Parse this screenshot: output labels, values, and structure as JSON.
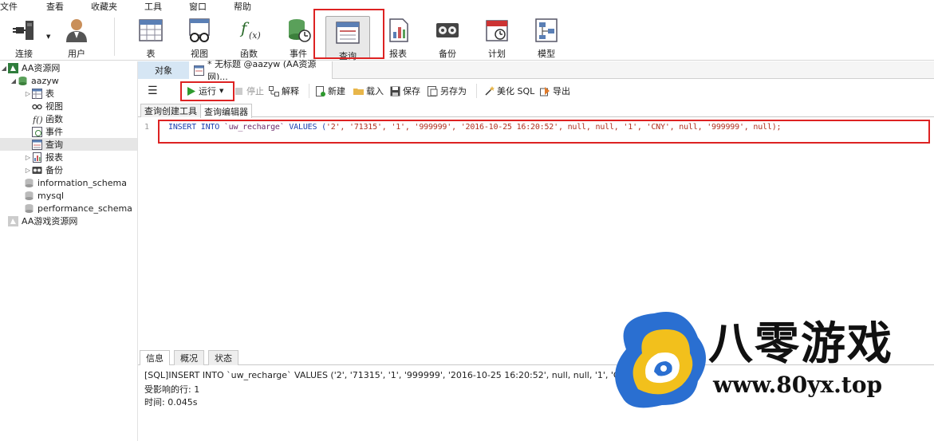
{
  "menu": [
    "文件",
    "查看",
    "收藏夹",
    "工具",
    "窗口",
    "帮助"
  ],
  "ribbon": {
    "items": [
      {
        "label": "连接",
        "icon": "plug-icon"
      },
      {
        "label": "用户",
        "icon": "user-icon"
      },
      {
        "label": "表",
        "icon": "table-icon"
      },
      {
        "label": "视图",
        "icon": "view-icon"
      },
      {
        "label": "函数",
        "icon": "function-icon"
      },
      {
        "label": "事件",
        "icon": "event-icon"
      },
      {
        "label": "查询",
        "icon": "query-icon"
      },
      {
        "label": "报表",
        "icon": "report-icon"
      },
      {
        "label": "备份",
        "icon": "backup-icon"
      },
      {
        "label": "计划",
        "icon": "schedule-icon"
      },
      {
        "label": "模型",
        "icon": "model-icon"
      }
    ]
  },
  "sidebar": {
    "connection": "AA资源网",
    "database": "aazyw",
    "children": [
      {
        "label": "表",
        "icon": "table-icon"
      },
      {
        "label": "视图",
        "icon": "view-icon"
      },
      {
        "label": "函数",
        "icon": "function-icon"
      },
      {
        "label": "事件",
        "icon": "event-icon"
      },
      {
        "label": "查询",
        "icon": "query-icon"
      },
      {
        "label": "报表",
        "icon": "report-icon"
      },
      {
        "label": "备份",
        "icon": "backup-icon"
      }
    ],
    "other_dbs": [
      "information_schema",
      "mysql",
      "performance_schema"
    ],
    "connection2": "AA游戏资源网"
  },
  "tabs": {
    "objects": "对象",
    "doc": "* 无标题 @aazyw (AA资源网)..."
  },
  "qtoolbar": {
    "run": "运行",
    "stop": "停止",
    "explain": "解释",
    "new": "新建",
    "load": "载入",
    "save": "保存",
    "save_as": "另存为",
    "beautify": "美化 SQL",
    "export": "导出"
  },
  "subtabs": [
    "查询创建工具",
    "查询编辑器"
  ],
  "editor": {
    "line": "1",
    "keyword": "INSERT INTO ",
    "table": "`uw_recharge`",
    "values_kw": " VALUES (",
    "args": "'2', '71315', '1', '999999', '2016-10-25 16:20:52', null, null, '1', 'CNY', null, '999999', null);"
  },
  "bottom_tabs": [
    "信息",
    "概况",
    "状态"
  ],
  "messages": {
    "sql": "[SQL]INSERT INTO `uw_recharge` VALUES ('2', '71315', '1', '999999', '2016-10-25 16:20:52', null, null, '1', 'CNY', null,",
    "affected": "受影响的行: 1",
    "time": "时间: 0.045s"
  },
  "watermark": {
    "title": "八零游戏",
    "url": "www.80yx.top"
  }
}
